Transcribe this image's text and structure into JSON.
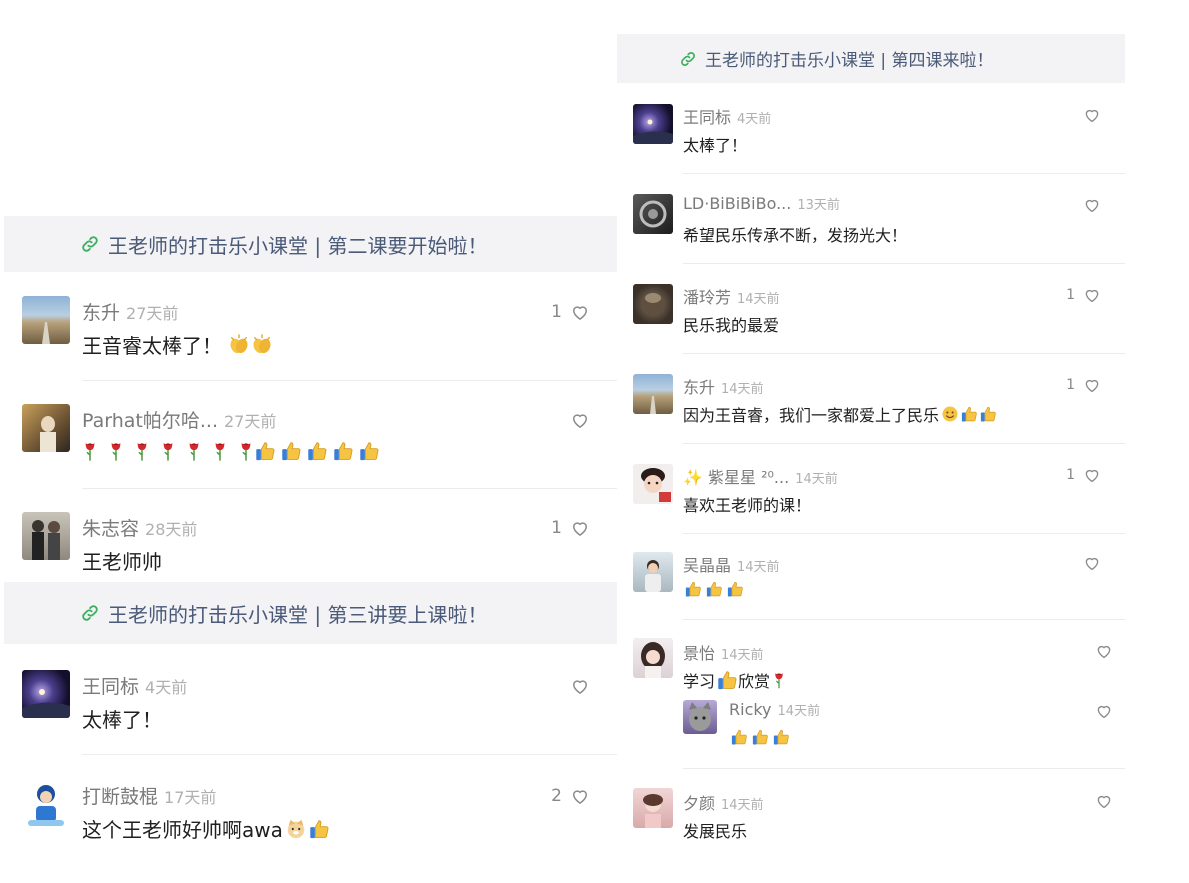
{
  "left": {
    "banner_1": "王老师的打击乐小课堂 | 第二课要开始啦！",
    "banner_2": "王老师的打击乐小课堂 | 第三讲要上课啦！",
    "comments": [
      {
        "name": "东升",
        "time": "27天前",
        "text": "王音睿太棒了！",
        "likes": "1"
      },
      {
        "name": "Parhat帕尔哈...",
        "time": "27天前",
        "text": "",
        "likes": ""
      },
      {
        "name": "朱志容",
        "time": "28天前",
        "text": "王老师帅",
        "likes": "1"
      },
      {
        "name": "王同标",
        "time": "4天前",
        "text": "太棒了！",
        "likes": ""
      },
      {
        "name": "打断鼓棍",
        "time": "17天前",
        "text": "这个王老师好帅啊awa",
        "likes": "2"
      }
    ]
  },
  "right": {
    "banner": "王老师的打击乐小课堂 | 第四课来啦！",
    "comments": [
      {
        "name": "王同标",
        "time": "4天前",
        "text": "太棒了！",
        "likes": ""
      },
      {
        "name": "LD·BiBiBiBo...",
        "time": "13天前",
        "text": "希望民乐传承不断，发扬光大！",
        "likes": ""
      },
      {
        "name": "潘玲芳",
        "time": "14天前",
        "text": "民乐我的最爱",
        "likes": "1"
      },
      {
        "name": "东升",
        "time": "14天前",
        "text": "因为王音睿，我们一家都爱上了民乐",
        "likes": "1"
      },
      {
        "name": "✨ 紫星星 ²⁰...",
        "time": "14天前",
        "text": "喜欢王老师的课！",
        "likes": "1"
      },
      {
        "name": "吴晶晶",
        "time": "14天前",
        "text": "",
        "likes": ""
      },
      {
        "name": "景怡",
        "time": "14天前",
        "text_before": "学习",
        "text_after": "欣赏",
        "likes": ""
      },
      {
        "name": "Ricky",
        "time": "14天前",
        "text": "",
        "likes": ""
      },
      {
        "name": "夕颜",
        "time": "14天前",
        "text": "发展民乐",
        "likes": ""
      }
    ]
  },
  "icons": {
    "link": "link-icon",
    "like": "heart-outline-icon",
    "thumb": "thumbs-up-emoji",
    "rose": "rose-emoji",
    "smile": "smiling-face-emoji"
  },
  "colors": {
    "banner_bg": "#f3f3f5",
    "banner_text": "#4a5a78",
    "link_icon": "#3bb15e",
    "name": "#7a7a7a",
    "time": "#b0b0b0"
  }
}
